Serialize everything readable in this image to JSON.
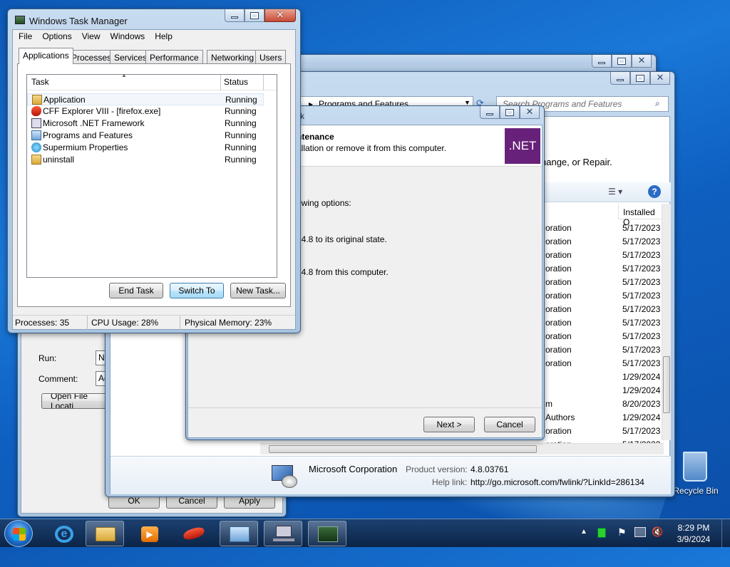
{
  "task_manager": {
    "title": "Windows Task Manager",
    "menu": [
      "File",
      "Options",
      "View",
      "Windows",
      "Help"
    ],
    "tabs": [
      "Applications",
      "Processes",
      "Services",
      "Performance",
      "Networking",
      "Users"
    ],
    "columns": {
      "task": "Task",
      "status": "Status"
    },
    "rows": [
      {
        "name": "Application",
        "status": "Running"
      },
      {
        "name": "CFF Explorer VIII - [firefox.exe]",
        "status": "Running"
      },
      {
        "name": "Microsoft .NET Framework",
        "status": "Running"
      },
      {
        "name": "Programs and Features",
        "status": "Running"
      },
      {
        "name": "Supermium Properties",
        "status": "Running"
      },
      {
        "name": "uninstall",
        "status": "Running"
      }
    ],
    "buttons": {
      "end_task": "End Task",
      "switch_to": "Switch To",
      "new_task": "New Task..."
    },
    "status_bar": {
      "processes": "Processes: 35",
      "cpu": "CPU Usage: 28%",
      "memory": "Physical Memory: 23%"
    }
  },
  "programs_features": {
    "address": "Programs and Features",
    "search_placeholder": "Search Programs and Features",
    "change_repair_text": "hange, or Repair.",
    "installed_col": "Installed O",
    "publisher_rows": [
      "oration",
      "oration",
      "oration",
      "oration",
      "oration",
      "oration",
      "oration",
      "oration",
      "oration",
      "oration",
      "oration",
      "",
      "",
      "m",
      "Authors",
      "oration",
      "oration"
    ],
    "date_rows": [
      "5/17/2023",
      "5/17/2023",
      "5/17/2023",
      "5/17/2023",
      "5/17/2023",
      "5/17/2023",
      "5/17/2023",
      "5/17/2023",
      "5/17/2023",
      "5/17/2023",
      "5/17/2023",
      "1/29/2024",
      "1/29/2024",
      "8/20/2023",
      "1/29/2024",
      "5/17/2023",
      "5/17/2023"
    ],
    "details": {
      "publisher": "Microsoft Corporation",
      "product_version_label": "Product version:",
      "product_version": "4.8.03761",
      "help_link_label": "Help link:",
      "help_link": "http://go.microsoft.com/fwlink/?LinkId=286134"
    }
  },
  "net_setup": {
    "title_fragment": "k",
    "heading": "ntenance",
    "subheading": "allation or remove it from this computer.",
    "badge": ".NET",
    "options_label": "owing options:",
    "option1": ": 4.8 to its original state.",
    "option2": ": 4.8 from this computer.",
    "next": "Next >",
    "cancel": "Cancel",
    "badge_color": "#68217a"
  },
  "properties": {
    "run_label": "Run:",
    "run_value": "No",
    "comment_label": "Comment:",
    "comment_value": "Ac",
    "open_file_location": "Open File Locati",
    "ok": "OK",
    "cancel": "Cancel",
    "apply": "Apply"
  },
  "desktop": {
    "recycle_bin": "Recycle Bin"
  },
  "taskbar": {
    "time": "8:29 PM",
    "date": "3/9/2024"
  }
}
